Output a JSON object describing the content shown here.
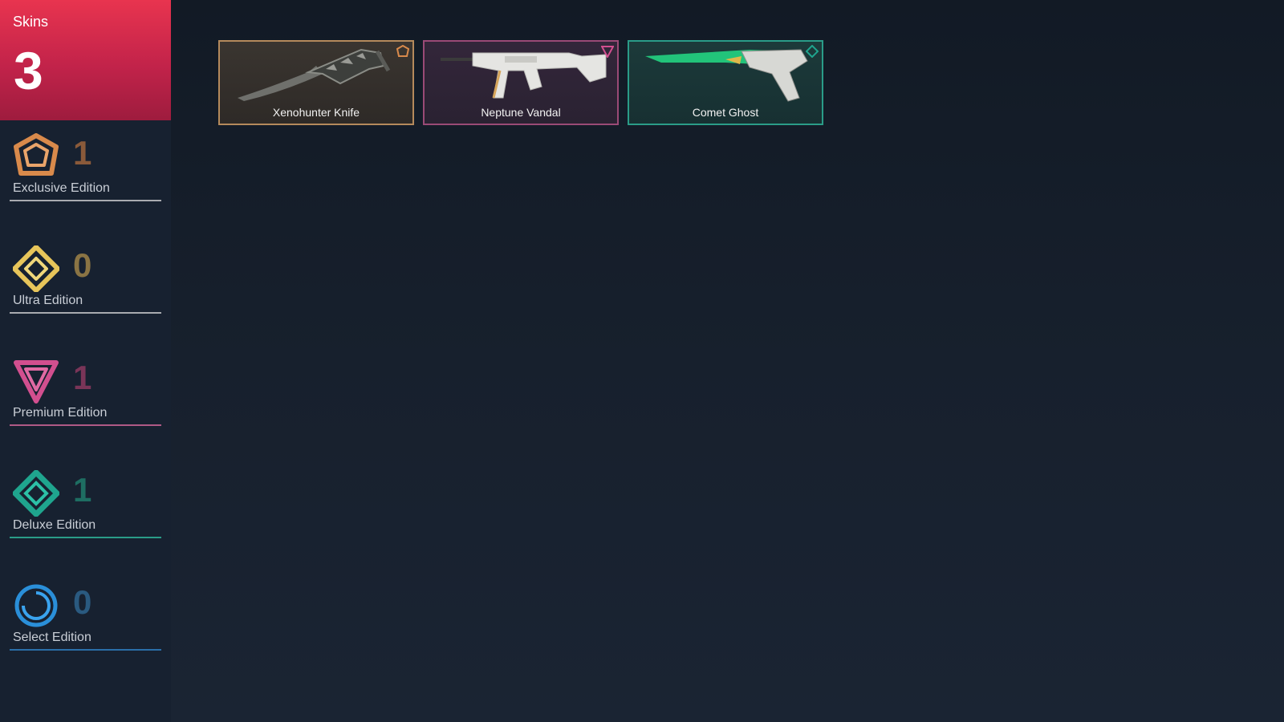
{
  "summary": {
    "label": "Skins",
    "total": "3"
  },
  "tiers": [
    {
      "count": "1",
      "label": "Exclusive Edition",
      "icon": "exclusive-edition-icon",
      "color": "#d98a4b",
      "count_color": "#8a5a3a"
    },
    {
      "count": "0",
      "label": "Ultra Edition",
      "icon": "ultra-edition-icon",
      "color": "#e7c55a",
      "count_color": "#8a7444"
    },
    {
      "count": "1",
      "label": "Premium Edition",
      "icon": "premium-edition-icon",
      "color": "#d24f8f",
      "count_color": "#7a3558"
    },
    {
      "count": "1",
      "label": "Deluxe Edition",
      "icon": "deluxe-edition-icon",
      "color": "#1fa58e",
      "count_color": "#1e6e62"
    },
    {
      "count": "0",
      "label": "Select Edition",
      "icon": "select-edition-icon",
      "color": "#2a8fd9",
      "count_color": "#2a5a80"
    }
  ],
  "skins": [
    {
      "name": "Xenohunter Knife",
      "tier": "Exclusive Edition",
      "icon": "knife-icon",
      "border": "#b58a5c"
    },
    {
      "name": "Neptune Vandal",
      "tier": "Premium Edition",
      "icon": "rifle-icon",
      "border": "#9a4a76"
    },
    {
      "name": "Comet Ghost",
      "tier": "Deluxe Edition",
      "icon": "pistol-icon",
      "border": "#2a9c88"
    }
  ]
}
